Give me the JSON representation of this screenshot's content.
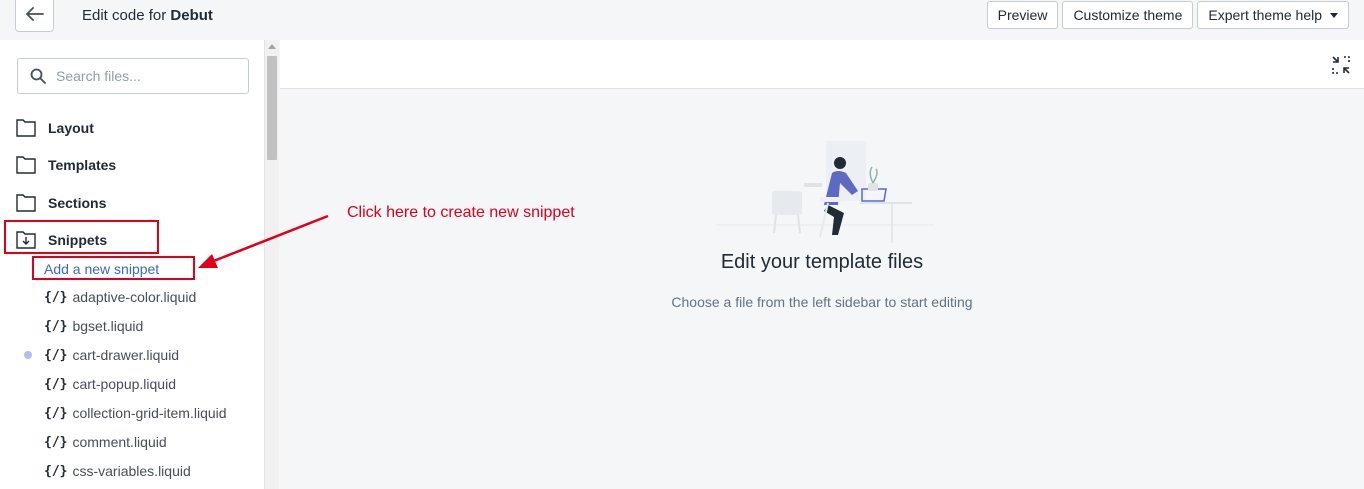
{
  "header": {
    "title_prefix": "Edit code for",
    "theme_name": "Debut",
    "preview_label": "Preview",
    "customize_label": "Customize theme",
    "expert_label": "Expert theme help"
  },
  "sidebar": {
    "search_placeholder": "Search files...",
    "folders": [
      {
        "label": "Layout",
        "icon": "folder-icon"
      },
      {
        "label": "Templates",
        "icon": "folder-icon"
      },
      {
        "label": "Sections",
        "icon": "folder-icon"
      },
      {
        "label": "Snippets",
        "icon": "folder-open-download-icon"
      }
    ],
    "add_snippet_label": "Add a new snippet",
    "code_icon_glyph": "{/}",
    "files": [
      {
        "name": "adaptive-color.liquid",
        "modified": false
      },
      {
        "name": "bgset.liquid",
        "modified": false
      },
      {
        "name": "cart-drawer.liquid",
        "modified": true
      },
      {
        "name": "cart-popup.liquid",
        "modified": false
      },
      {
        "name": "collection-grid-item.liquid",
        "modified": false
      },
      {
        "name": "comment.liquid",
        "modified": false
      },
      {
        "name": "css-variables.liquid",
        "modified": false
      }
    ]
  },
  "editor": {
    "empty_title": "Edit your template files",
    "empty_subtitle": "Choose a file from the left sidebar to start editing"
  },
  "annotation": {
    "text": "Click here to create new snippet",
    "color": "#e0001b"
  },
  "colors": {
    "link": "#3a69c7",
    "modified_dot": "#b3bcf5",
    "illustration_accent": "#5c6ac4"
  }
}
